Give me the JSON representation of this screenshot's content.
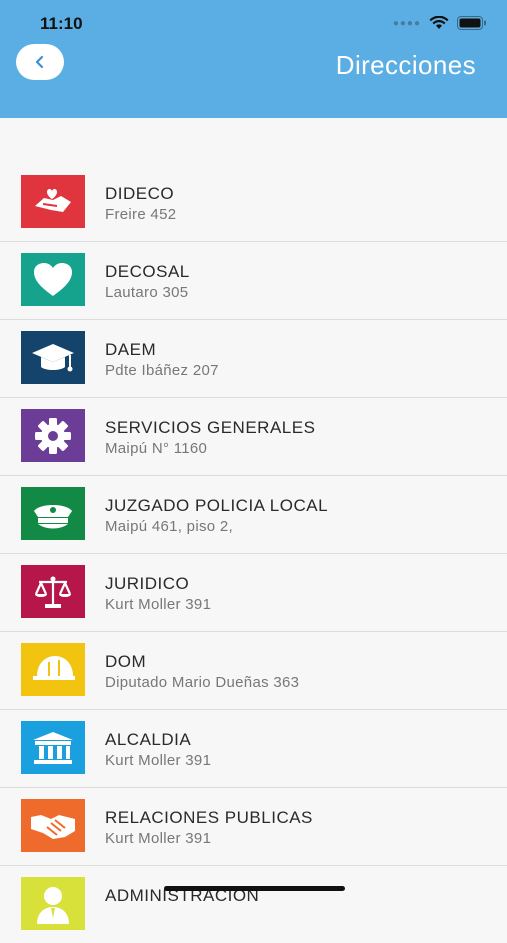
{
  "status_bar": {
    "time": "11:10"
  },
  "header": {
    "title": "Direcciones",
    "back_icon": "chevron-left-icon"
  },
  "items": [
    {
      "title": "DIDECO",
      "subtitle": "Freire 452",
      "icon": "hands-heart-icon",
      "color": "#e0353f"
    },
    {
      "title": "DECOSAL",
      "subtitle": "Lautaro 305",
      "icon": "heart-icon",
      "color": "#15a38d"
    },
    {
      "title": "DAEM",
      "subtitle": "Pdte Ibáñez 207",
      "icon": "graduation-cap-icon",
      "color": "#14446b"
    },
    {
      "title": "SERVICIOS GENERALES",
      "subtitle": "Maipú N° 1160",
      "icon": "gear-icon",
      "color": "#6b3d96"
    },
    {
      "title": "JUZGADO POLICIA LOCAL",
      "subtitle": "Maipú 461, piso 2,",
      "icon": "police-cap-icon",
      "color": "#128a45"
    },
    {
      "title": "JURIDICO",
      "subtitle": "Kurt Moller 391",
      "icon": "scales-icon",
      "color": "#b7164a"
    },
    {
      "title": "DOM",
      "subtitle": "Diputado Mario Dueñas 363",
      "icon": "hard-hat-icon",
      "color": "#f2c30f"
    },
    {
      "title": "ALCALDIA",
      "subtitle": "Kurt Moller 391",
      "icon": "government-building-icon",
      "color": "#1aa0de"
    },
    {
      "title": "RELACIONES PUBLICAS",
      "subtitle": "Kurt Moller 391",
      "icon": "handshake-icon",
      "color": "#ef6b2b"
    },
    {
      "title": "ADMINISTRACION",
      "subtitle": "",
      "icon": "person-icon",
      "color": "#d8e03a"
    }
  ]
}
